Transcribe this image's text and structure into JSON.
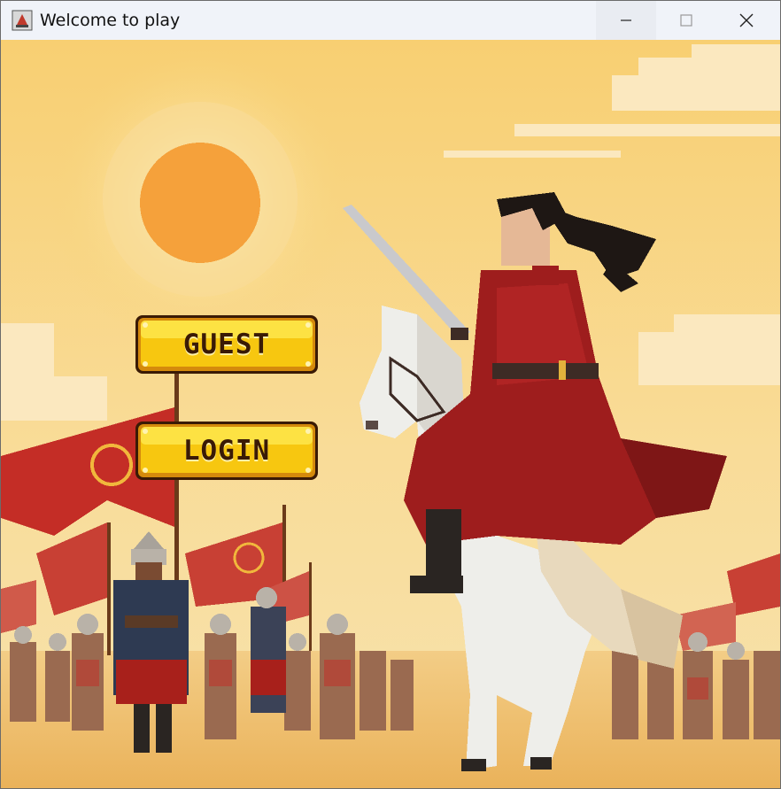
{
  "window": {
    "title": "Welcome to play",
    "icon": "java-app-icon",
    "controls": [
      "minimize-icon",
      "maximize-icon",
      "close-icon"
    ]
  },
  "menu": {
    "guest_label": "GUEST",
    "login_label": "LOGIN"
  },
  "colors": {
    "sky": "#f8d47a",
    "sun": "#f5a13b",
    "button_gold": "#f7c710",
    "button_border": "#3a1a05",
    "banner_red": "#c42d26",
    "rider_red": "#9e1d1d"
  }
}
